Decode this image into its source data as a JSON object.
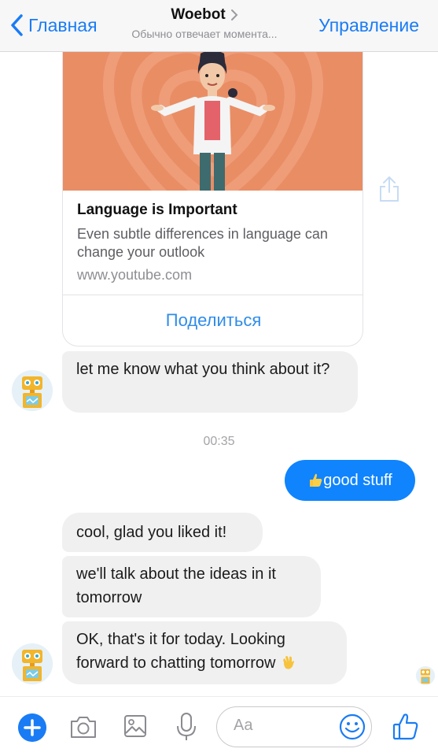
{
  "header": {
    "back_label": "Главная",
    "title": "Woebot",
    "subtitle": "Обычно отвечает момента...",
    "manage_label": "Управление"
  },
  "link_card": {
    "title": "Language is Important",
    "description": "Even subtle differences in language can change your outlook",
    "url": "www.youtube.com",
    "share_label": "Поделиться"
  },
  "messages": {
    "m1": "let me know what you think about it?",
    "timestamp": "00:35",
    "outgoing": "good stuff",
    "m3": "cool, glad you liked it!",
    "m4": "we'll talk about the ideas in it tomorrow",
    "m5": "OK, that's it for today. Looking forward to chatting tomorrow"
  },
  "composer": {
    "placeholder": "Aa"
  },
  "colors": {
    "accent": "#1a7cf4",
    "outgoing_bubble": "#0f84fd",
    "incoming_bubble": "#f0f0f1",
    "thumbnail_bg": "#e98d65"
  },
  "icons": [
    "chevron-left-icon",
    "chevron-right-icon",
    "share-out-icon",
    "thumbs-up-emoji",
    "waving-hand-emoji",
    "plus-icon",
    "camera-icon",
    "image-icon",
    "microphone-icon",
    "smiley-icon",
    "like-icon"
  ]
}
